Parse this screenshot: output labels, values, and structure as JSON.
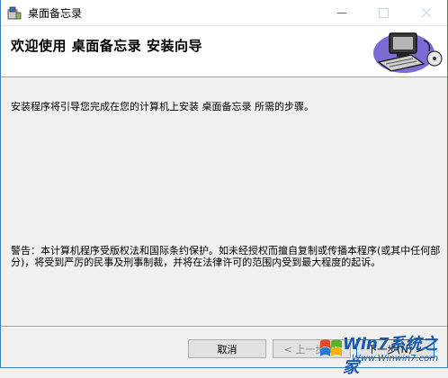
{
  "window": {
    "title": "桌面备忘录"
  },
  "banner": {
    "title": "欢迎使用  桌面备忘录  安装向导"
  },
  "content": {
    "intro": "安装程序将引导您完成在您的计算机上安装 桌面备忘录 所需的步骤。",
    "warning": "警告：本计算机程序受版权法和国际条约保护。如未经授权而擅自复制或传播本程序(或其中任何部分)，将受到严厉的民事及刑事制裁，并将在法律许可的范围内受到最大程度的起诉。"
  },
  "buttons": {
    "cancel": "取消",
    "back": "< 上一步(B)",
    "next": "下一步(N) >"
  },
  "watermark": {
    "line1": "Win7系统之家",
    "line2": "Www.Winwin7.com"
  },
  "icons": {
    "app": "installer-icon",
    "banner": "computer-install-illustration",
    "minimize": "minimize-icon",
    "maximize": "maximize-icon",
    "close": "close-icon"
  },
  "colors": {
    "border": "#3c7fb1",
    "watermark": "#1a5aa8",
    "focus": "#0078d7"
  }
}
